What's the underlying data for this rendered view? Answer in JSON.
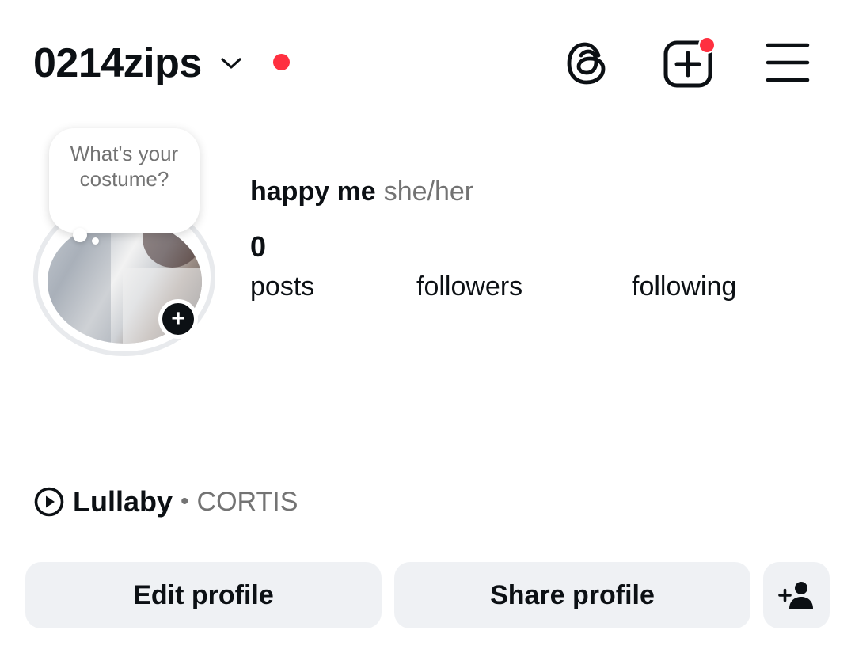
{
  "header": {
    "username": "0214zips",
    "has_unread_notification": true,
    "threads_icon": "threads-icon",
    "create_icon": "create-post-icon",
    "menu_icon": "hamburger-menu-icon",
    "accent_red": "#ff3040"
  },
  "note": {
    "text": "What's your costume?"
  },
  "profile": {
    "display_name": "happy me",
    "pronouns": "she/her",
    "stats": {
      "posts_count": "0",
      "posts_label": "posts",
      "followers_label": "followers",
      "following_label": "following"
    }
  },
  "music": {
    "icon": "play-circle-icon",
    "song": "Lullaby",
    "separator": "•",
    "artist": "CORTIS"
  },
  "actions": {
    "edit_profile": "Edit profile",
    "share_profile": "Share profile",
    "discover_icon": "add-person-icon"
  },
  "colors": {
    "text_primary": "#0c1014",
    "text_secondary": "#737373",
    "button_bg": "#eff1f4"
  }
}
